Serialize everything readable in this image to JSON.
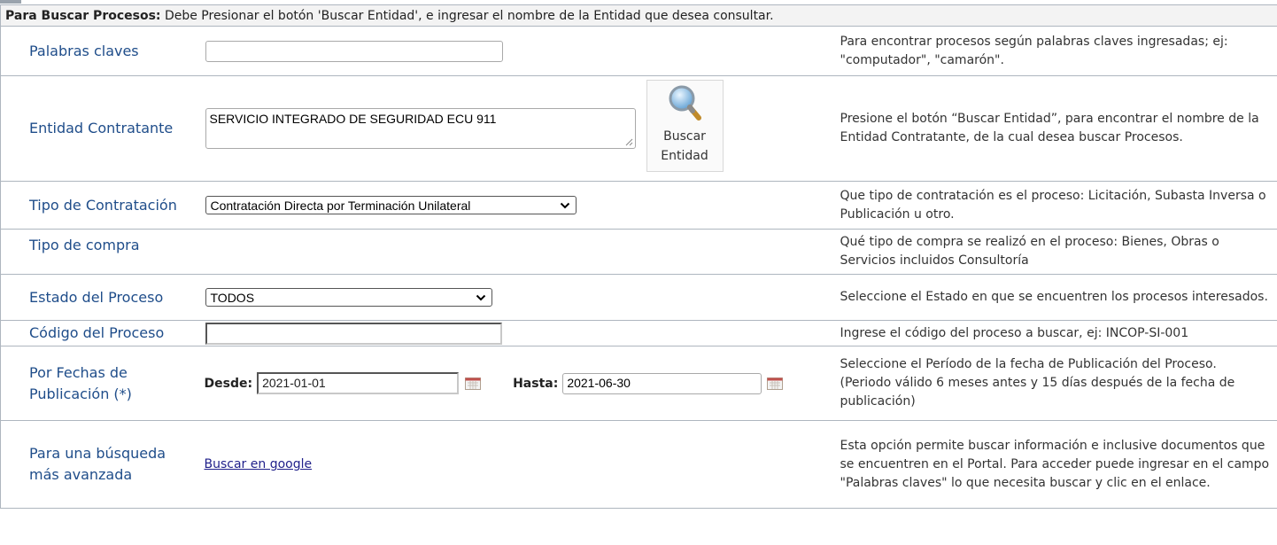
{
  "instructions": {
    "bold_prefix": "Para Buscar Procesos:",
    "text": " Debe Presionar el botón 'Buscar Entidad', e ingresar el nombre de la Entidad que desea consultar."
  },
  "rows": {
    "keywords": {
      "label": "Palabras claves",
      "value": "",
      "help": "Para encontrar procesos según palabras claves ingresadas; ej: \"computador\", \"camarón\"."
    },
    "entity": {
      "label": "Entidad Contratante",
      "value": "SERVICIO INTEGRADO DE SEGURIDAD ECU 911",
      "button_line1": "Buscar",
      "button_line2": "Entidad",
      "button_icon": "magnifier-icon",
      "help": "Presione el botón “Buscar Entidad”, para encontrar el nombre de la Entidad Contratante, de la cual desea buscar Procesos."
    },
    "contract_type": {
      "label": "Tipo de Contratación",
      "selected": "Contratación Directa por Terminación Unilateral",
      "help": "Que tipo de contratación es el proceso: Licitación, Subasta Inversa o Publicación u otro."
    },
    "purchase_type": {
      "label": "Tipo de compra",
      "help": "Qué tipo de compra se realizó en el proceso: Bienes, Obras o Servicios incluidos Consultoría"
    },
    "status": {
      "label": "Estado del Proceso",
      "selected": "TODOS",
      "help": "Seleccione el Estado en que se encuentren los procesos interesados."
    },
    "code": {
      "label": "Código del Proceso",
      "value": "",
      "help": "Ingrese el código del proceso a buscar, ej: INCOP-SI-001"
    },
    "dates": {
      "label_line1": "Por Fechas de",
      "label_line2": "Publicación (*)",
      "from_label": "Desde:",
      "from_value": "2021-01-01",
      "to_label": "Hasta:",
      "to_value": "2021-06-30",
      "help_line1": "Seleccione el Período de la fecha de Publicación del Proceso.",
      "help_line2": "(Periodo válido 6 meses antes y 15 días después de la fecha de publicación)"
    },
    "advanced": {
      "label_line1": "Para una búsqueda",
      "label_line2": "más avanzada",
      "link": "Buscar en google",
      "help": "Esta opción permite buscar información e inclusive documentos que se encuentren en el Portal. Para acceder puede ingresar en el campo \"Palabras claves\" lo que necesita buscar y clic en el enlace."
    }
  },
  "colors": {
    "label": "#1f4d8a",
    "border": "#aeb6bf",
    "instruction_bg": "#f3f3f3",
    "link": "#1f1f8a"
  }
}
